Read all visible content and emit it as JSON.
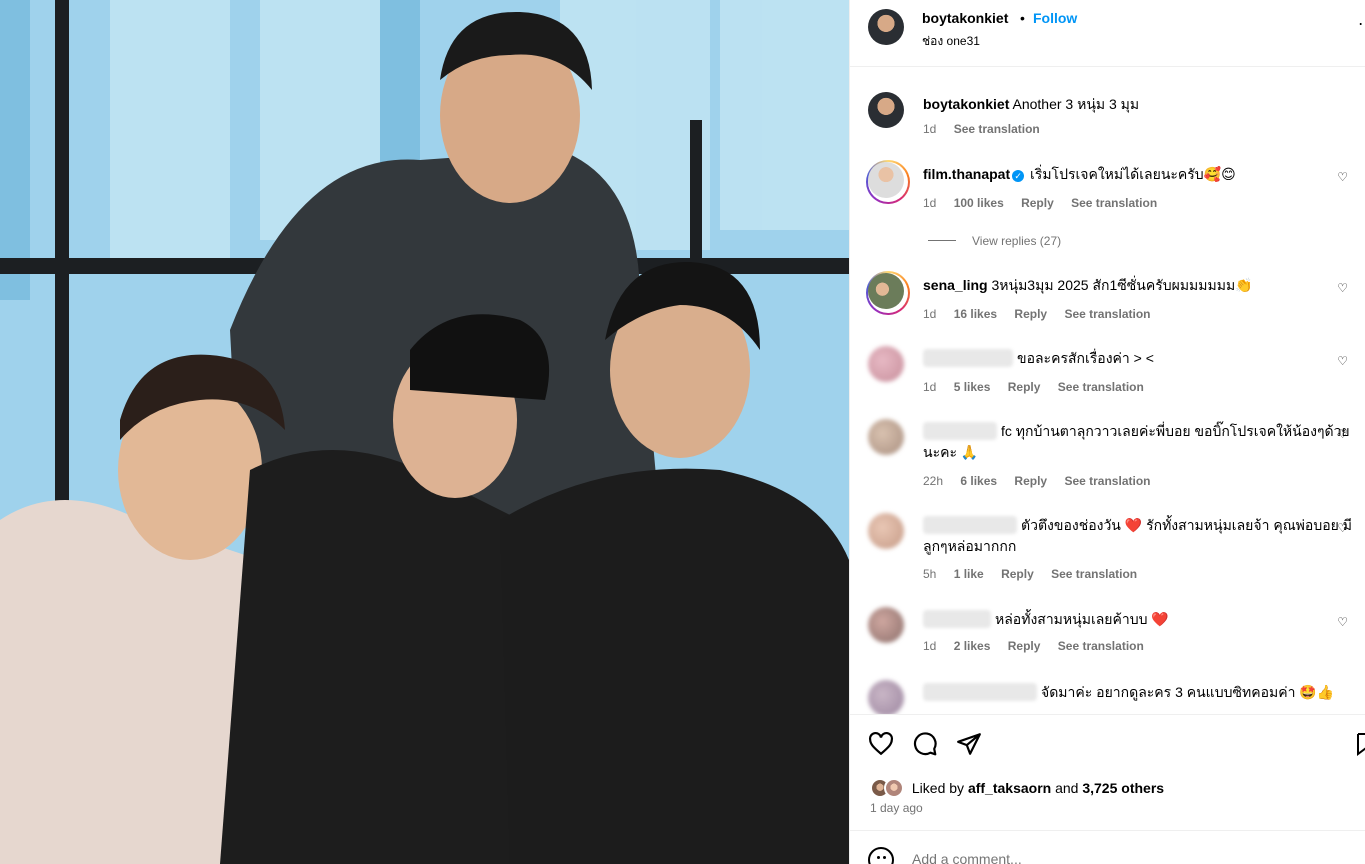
{
  "post": {
    "author": "boytakonkiet",
    "separator": "•",
    "follow_label": "Follow",
    "subtitle": "ช่อง one31",
    "more_icon": "more-horizontal-icon"
  },
  "caption": {
    "user": "boytakonkiet",
    "text": "Another 3 หนุ่ม 3 มุม",
    "time": "1d",
    "see_translation": "See translation"
  },
  "comments": [
    {
      "user": "film.thanapat",
      "verified": true,
      "text": "เริ่มโปรเจคใหม่ได้เลยนะครับ🥰😊",
      "time": "1d",
      "likes": "100 likes",
      "reply": "Reply",
      "see_translation": "See translation"
    },
    {
      "user": "sena_ling",
      "text": "3หนุ่ม3มุม 2025 สัก1ซีซั่นครับผมมมมมม👏",
      "time": "1d",
      "likes": "16 likes",
      "reply": "Reply",
      "see_translation": "See translation"
    },
    {
      "user": "",
      "text": "ขอละครสักเรื่องค่า > <",
      "time": "1d",
      "likes": "5 likes",
      "reply": "Reply",
      "see_translation": "See translation"
    },
    {
      "user": "",
      "text": "fc ทุกบ้านตาลุกวาวเลยค่ะพี่บอย ขอบิ๊กโปรเจคให้น้องๆด้วยนะคะ 🙏",
      "time": "22h",
      "likes": "6 likes",
      "reply": "Reply",
      "see_translation": "See translation"
    },
    {
      "user": "",
      "text": "ตัวตึงของช่องวัน ❤️ รักทั้งสามหนุ่มเลยจ้า คุณพ่อบอย มีลูกๆหล่อมากกก",
      "time": "5h",
      "likes": "1 like",
      "reply": "Reply",
      "see_translation": "See translation"
    },
    {
      "user": "",
      "text": "หล่อทั้งสามหนุ่มเลยค้าบบ ❤️",
      "time": "1d",
      "likes": "2 likes",
      "reply": "Reply",
      "see_translation": "See translation"
    },
    {
      "user": "",
      "text": "จัดมาค่ะ อยากดูละคร 3 คนแบบซิทคอมค่า 🤩👍"
    }
  ],
  "view_replies": "View replies (27)",
  "actions": {
    "icons": [
      "heart-icon",
      "comment-icon",
      "share-icon",
      "bookmark-icon"
    ]
  },
  "likes": {
    "prefix": "Liked by",
    "user": "aff_taksaorn",
    "and": "and",
    "others": "3,725 others"
  },
  "timestamp": "1 day ago",
  "add_comment": {
    "placeholder": "Add a comment..."
  },
  "colors": {
    "accent": "#0095f6",
    "secondary_text": "#737373",
    "heart": "#ed4956"
  }
}
